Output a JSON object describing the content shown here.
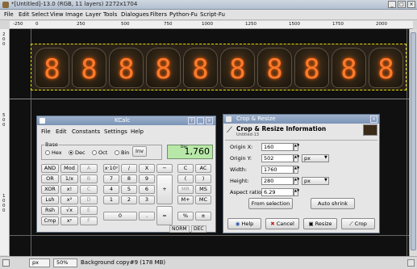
{
  "gimp": {
    "title": "*[Untitled]-13.0 (RGB, 11 layers) 2272x1704",
    "menu": [
      "File",
      "Edit",
      "Select",
      "View",
      "Image",
      "Layer",
      "Tools",
      "Dialogues",
      "Filters",
      "Python-Fu",
      "Script-Fu"
    ],
    "ruler_top": [
      "-250",
      "0",
      "250",
      "500",
      "750",
      "1000",
      "1250",
      "1500",
      "1750",
      "2000"
    ],
    "ruler_left": [
      "2",
      "0",
      "0",
      "5",
      "0",
      "0",
      "1",
      "0",
      "0",
      "0"
    ],
    "digits": [
      "8",
      "8",
      "8",
      "8",
      "8",
      "8",
      "8",
      "8",
      "8",
      "8"
    ],
    "status": {
      "unit": "px",
      "zoom": "50%",
      "layer_info": "Background copy#9 (178 MB)"
    }
  },
  "kcalc": {
    "title": "KCalc",
    "menu": [
      "File",
      "Edit",
      "Constants",
      "Settings",
      "Help"
    ],
    "base_label": "Base",
    "bases": [
      "Hex",
      "Dec",
      "Oct",
      "Bin"
    ],
    "selected_base": "Dec",
    "inv": "Inv",
    "display_mode": "Dec",
    "display_value": "1,760",
    "buttons": {
      "and": "AND",
      "mod": "Mod",
      "a": "A",
      "x10y": "x·10ʸ",
      "div": "/",
      "x": "X",
      "minus": "−",
      "c": "C",
      "ac": "AC",
      "or": "OR",
      "inv_x": "1/x",
      "b": "B",
      "n7": "7",
      "n8": "8",
      "n9": "9",
      "lparen": "(",
      "rparen": ")",
      "xor": "XOR",
      "xfact": "x!",
      "c_hex": "C",
      "n4": "4",
      "n5": "5",
      "n6": "6",
      "plus": "+",
      "mr": "MR",
      "ms": "MS",
      "lsh": "Lsh",
      "x2": "x²",
      "d": "D",
      "n1": "1",
      "n2": "2",
      "n3": "3",
      "mplus": "M+",
      "mc": "MC",
      "rsh": "Rsh",
      "root": "√x",
      "e": "E",
      "n0": "0",
      "dot": ".",
      "eq": "=",
      "pct": "%",
      "pm": "±",
      "cmp": "Cmp",
      "xy": "xʸ",
      "f": "F"
    },
    "status_norm": "NORM",
    "status_dec": "DEC"
  },
  "crop": {
    "title": "Crop & Resize",
    "heading": "Crop & Resize Information",
    "subheading": "Untitled-13",
    "origin_x_label": "Origin X:",
    "origin_x": "160",
    "origin_y_label": "Origin Y:",
    "origin_y": "502",
    "width_label": "Width:",
    "width": "1760",
    "height_label": "Height:",
    "height": "280",
    "aspect_label": "Aspect ratio:",
    "aspect": "6.29",
    "unit1": "px",
    "unit2": "px",
    "from_selection": "From selection",
    "auto_shrink": "Auto shrink",
    "help": "Help",
    "cancel": "Cancel",
    "resize": "Resize",
    "crop": "Crop"
  }
}
